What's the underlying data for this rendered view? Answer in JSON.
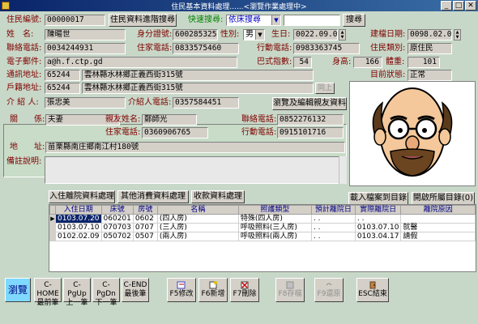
{
  "window": {
    "title": "住民基本資料處理......<瀏覽作業處理中>",
    "min": "_",
    "max": "□",
    "close": "✕"
  },
  "row1": {
    "resident_id_label": "住民編號:",
    "resident_id": "00000017",
    "advanced_search_btn": "住民資料進階搜尋",
    "quick_search_label": "快速搜尋:",
    "quick_search_mode": "依床搜尋",
    "search_btn": "搜尋"
  },
  "row2": {
    "name_label": "姓　名:",
    "name": "陳暘世",
    "id_label": "身分證號:",
    "id_no": "6002853254",
    "gender_label": "性別:",
    "gender": "男",
    "birth_label": "生日:",
    "birth": "0022.09.08",
    "built_label": "建檔日期:",
    "built": "0098.02.05"
  },
  "row3": {
    "phone_label": "聯絡電話:",
    "phone": "0034244931",
    "home_label": "住家電話:",
    "home": "0833575460",
    "mobile_label": "行動電話:",
    "mobile": "0983363745",
    "category_label": "住民類別:",
    "category": "原住民"
  },
  "row4": {
    "email_label": "電子郵件:",
    "email": "a@h.f.ctp.gd",
    "ba_label": "巴式指數:",
    "ba": "54",
    "height_label": "身高:",
    "height": "166",
    "weight_label": "體重:",
    "weight": "101"
  },
  "row5": {
    "mail_label": "通訊地址:",
    "mail_zip": "65244",
    "mail_addr": "雲林縣水林鄉正義西街315號",
    "status_label": "目前狀態:",
    "status": "正常"
  },
  "row6": {
    "reg_label": "戶籍地址:",
    "reg_zip": "65244",
    "reg_addr": "雲林縣水林鄉正義西街315號",
    "same_btn": "同上"
  },
  "row7": {
    "ref_label": "介 紹 人:",
    "ref": "張忠美",
    "ref_phone_label": "介紹人電話:",
    "ref_phone": "0357584451",
    "browse_family_btn": "瀏覽及編輯親友資料"
  },
  "family": {
    "relation_label": "關　　係:",
    "relation": "夫妻",
    "fname_label": "親友姓名:",
    "fname": "鄭師光",
    "fphone_label": "聯絡電話:",
    "fphone": "0852276132",
    "fhome_label": "住家電話:",
    "fhome": "0360906765",
    "fmobile_label": "行動電話:",
    "fmobile": "0915101716",
    "faddr_label": "地　　址:",
    "faddr": "苗栗縣南庄鄉南江村180號"
  },
  "remark_label": "備註說明:",
  "tabs": {
    "discharge": "入住離院資料處理",
    "other_fee": "其他消費資料處理",
    "payment": "收款資料處理",
    "load_file": "載入檔案到目錄",
    "open_dir": "開啟所屬目錄(0)"
  },
  "grid": {
    "headers": [
      "入住日期",
      "床號",
      "房號",
      "名稱",
      "照護類型",
      "預計離院日",
      "實際離院日",
      "離院原因"
    ],
    "rows": [
      [
        "0103.07.20",
        "060201",
        "0602",
        "(四人房)",
        "特殊(四人房)",
        ". .",
        ". .",
        ""
      ],
      [
        "0103.07.10",
        "070703",
        "0707",
        "(三人房)",
        "呼吸照料(三人房)",
        ". .",
        "0103.07.10",
        "就醫"
      ],
      [
        "0102.02.09",
        "050702",
        "0507",
        "(兩人房)",
        "呼吸照料(兩人房)",
        ". .",
        "0103.04.17",
        "請假"
      ]
    ]
  },
  "toolbar": {
    "browse": "瀏覽",
    "first_key": "C-HOME",
    "first": "最前筆",
    "prev_key": "C-PgUp",
    "prev": "上一筆",
    "next_key": "C-PgDn",
    "next": "下一筆",
    "last_key": "C-END",
    "last": "最後筆",
    "edit": "F5修改",
    "new": "F6新增",
    "delete": "F7刪除",
    "save": "F8存檔",
    "restore": "F9還原",
    "exit": "ESC結束"
  },
  "colors": {
    "title_bar": "#0a246a",
    "background": "#c8d8c8",
    "label": "#800000",
    "browse_button": "#7ed8ff"
  }
}
